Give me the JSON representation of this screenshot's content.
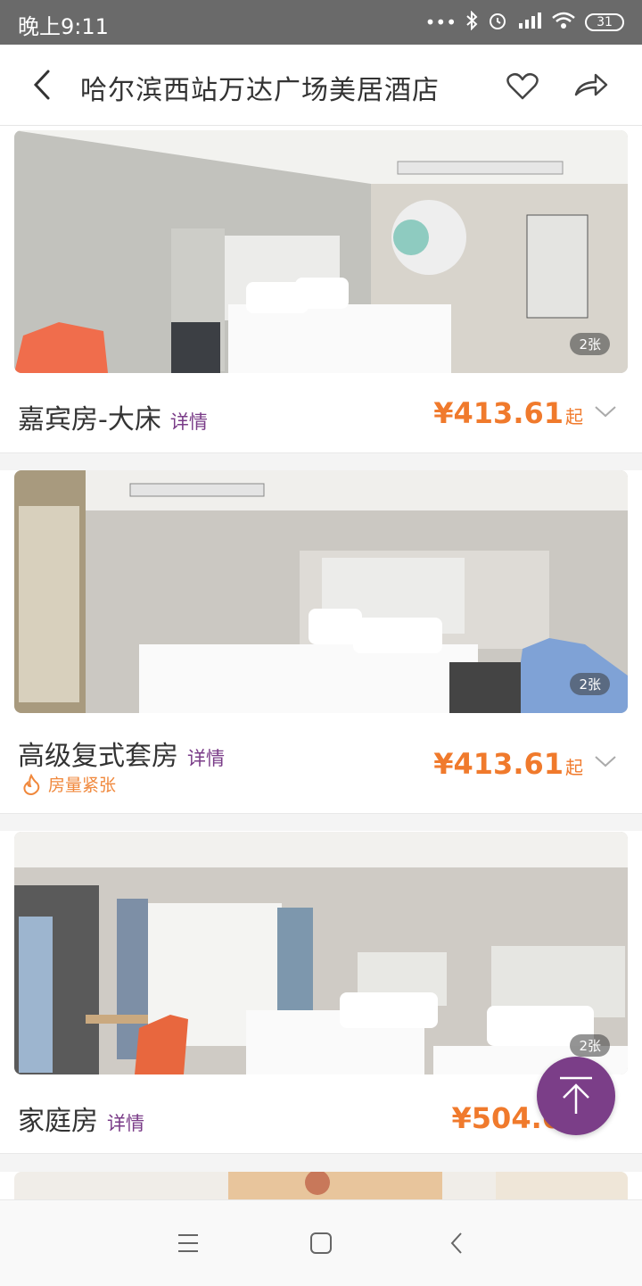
{
  "status": {
    "time": "晚上9:11",
    "battery": "31"
  },
  "header": {
    "title": "哈尔滨西站万达广场美居酒店"
  },
  "rooms": [
    {
      "name": "嘉宾房-大床",
      "detail": "详情",
      "price": "¥413.61",
      "from": "起",
      "photos": "2张"
    },
    {
      "name": "高级复式套房",
      "detail": "详情",
      "price": "¥413.61",
      "from": "起",
      "photos": "2张",
      "tag": "房量紧张"
    },
    {
      "name": "家庭房",
      "detail": "详情",
      "price": "¥504.6",
      "from": "",
      "photos": "2张"
    }
  ],
  "colors": {
    "accent": "#7a3c88",
    "price": "#f07a2c",
    "statusbar": "#6a6a6a"
  },
  "icons": [
    "back-icon",
    "heart-icon",
    "share-icon",
    "chevron-down-icon",
    "fire-icon",
    "arrow-up-icon",
    "menu-icon",
    "home-icon",
    "nav-back-icon"
  ]
}
